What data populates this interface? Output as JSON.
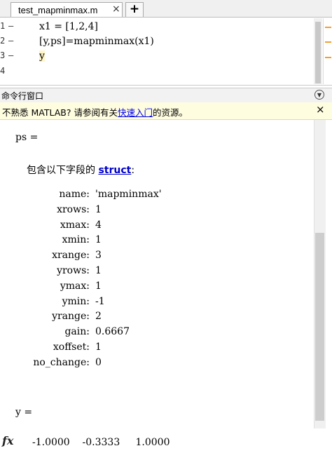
{
  "editor": {
    "tab_title": "test_mapminmax.m",
    "tab_close_glyph": "×",
    "add_tab_glyph": "+",
    "lines": [
      {
        "number": "1",
        "code": "x1 = [1,2,4]"
      },
      {
        "number": "2",
        "code": "[y,ps]=mapminmax(x1)"
      },
      {
        "number": "3",
        "code": "y"
      },
      {
        "number": "4",
        "code": ""
      }
    ],
    "line_dash": "—"
  },
  "command_window": {
    "title": "命令行窗口",
    "menu_icon": "chevron-down-circle-icon",
    "info_prefix": "不熟悉 MATLAB? 请参阅有关",
    "info_link": "快速入门",
    "info_suffix": "的资源。",
    "info_close_glyph": "×",
    "ps_header": "ps =",
    "struct_intro": "包含以下字段的",
    "struct_word": "struct",
    "struct_colon": ":",
    "fields": [
      {
        "name": "name:",
        "value": "'mapminmax'"
      },
      {
        "name": "xrows:",
        "value": "1"
      },
      {
        "name": "xmax:",
        "value": "4"
      },
      {
        "name": "xmin:",
        "value": "1"
      },
      {
        "name": "xrange:",
        "value": "3"
      },
      {
        "name": "yrows:",
        "value": "1"
      },
      {
        "name": "ymax:",
        "value": "1"
      },
      {
        "name": "ymin:",
        "value": "-1"
      },
      {
        "name": "yrange:",
        "value": "2"
      },
      {
        "name": "gain:",
        "value": "0.6667"
      },
      {
        "name": "xoffset:",
        "value": "1"
      },
      {
        "name": "no_change:",
        "value": "0"
      }
    ],
    "y_header": "y =",
    "y_values": "-1.0000    -0.3333     1.0000",
    "prompt_glyph": "fx"
  }
}
